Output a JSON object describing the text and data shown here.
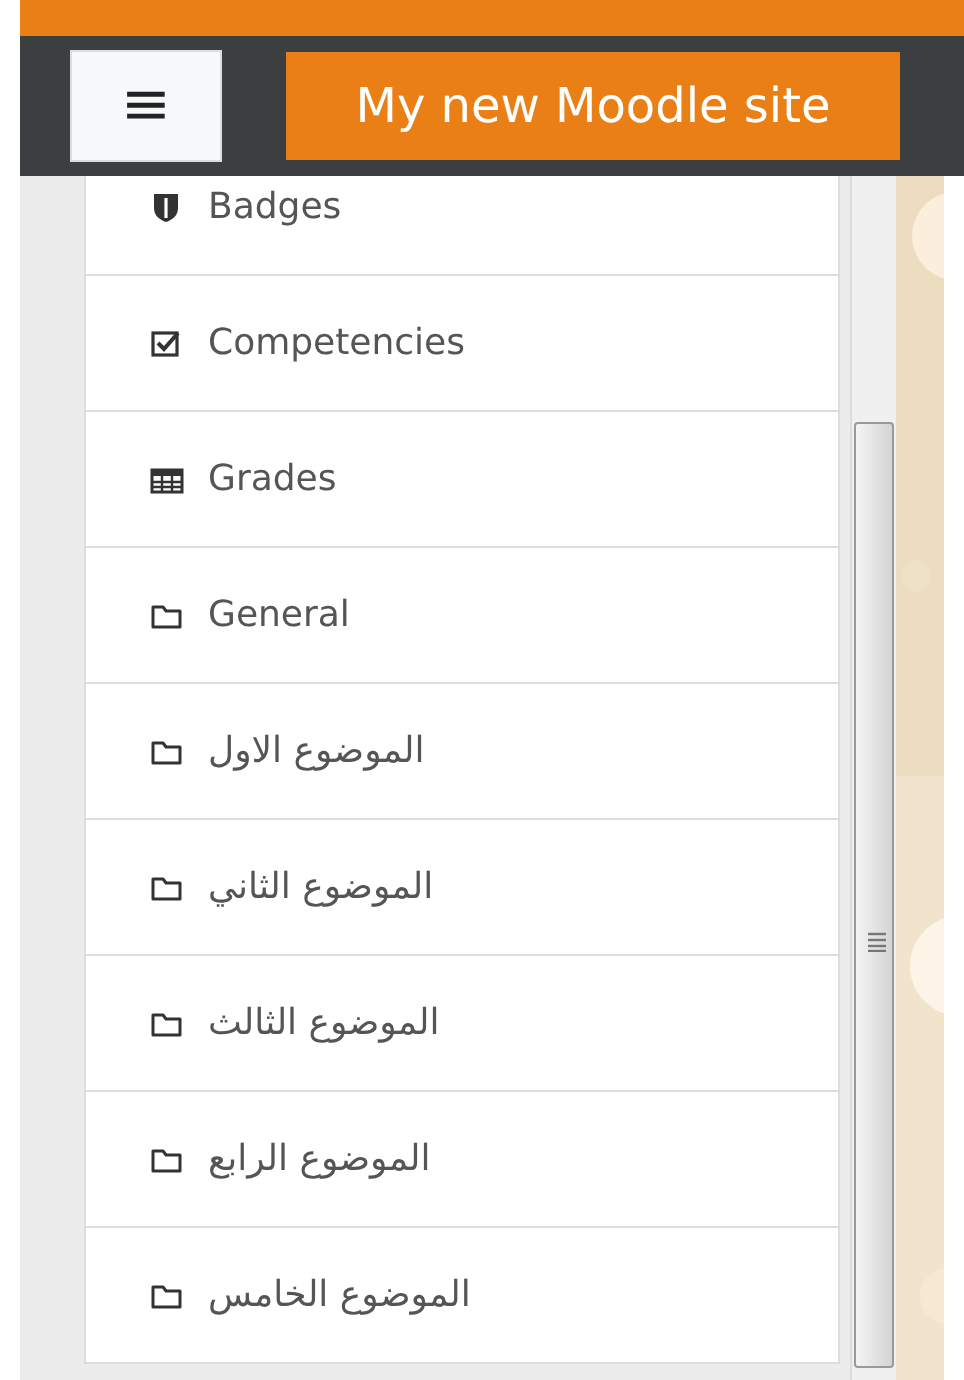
{
  "navbar": {
    "menu_button": "≡",
    "site_name": "My new Moodle site"
  },
  "nav_items": [
    {
      "kind": "badges",
      "label": "Badges"
    },
    {
      "kind": "competencies",
      "label": "Competencies"
    },
    {
      "kind": "grades",
      "label": "Grades"
    },
    {
      "kind": "folder",
      "label": "General"
    },
    {
      "kind": "folder",
      "label": "الموضوع الاول"
    },
    {
      "kind": "folder",
      "label": "الموضوع الثاني"
    },
    {
      "kind": "folder",
      "label": "الموضوع الثالث"
    },
    {
      "kind": "folder",
      "label": "الموضوع الرابع"
    },
    {
      "kind": "folder",
      "label": "الموضوع الخامس"
    }
  ]
}
